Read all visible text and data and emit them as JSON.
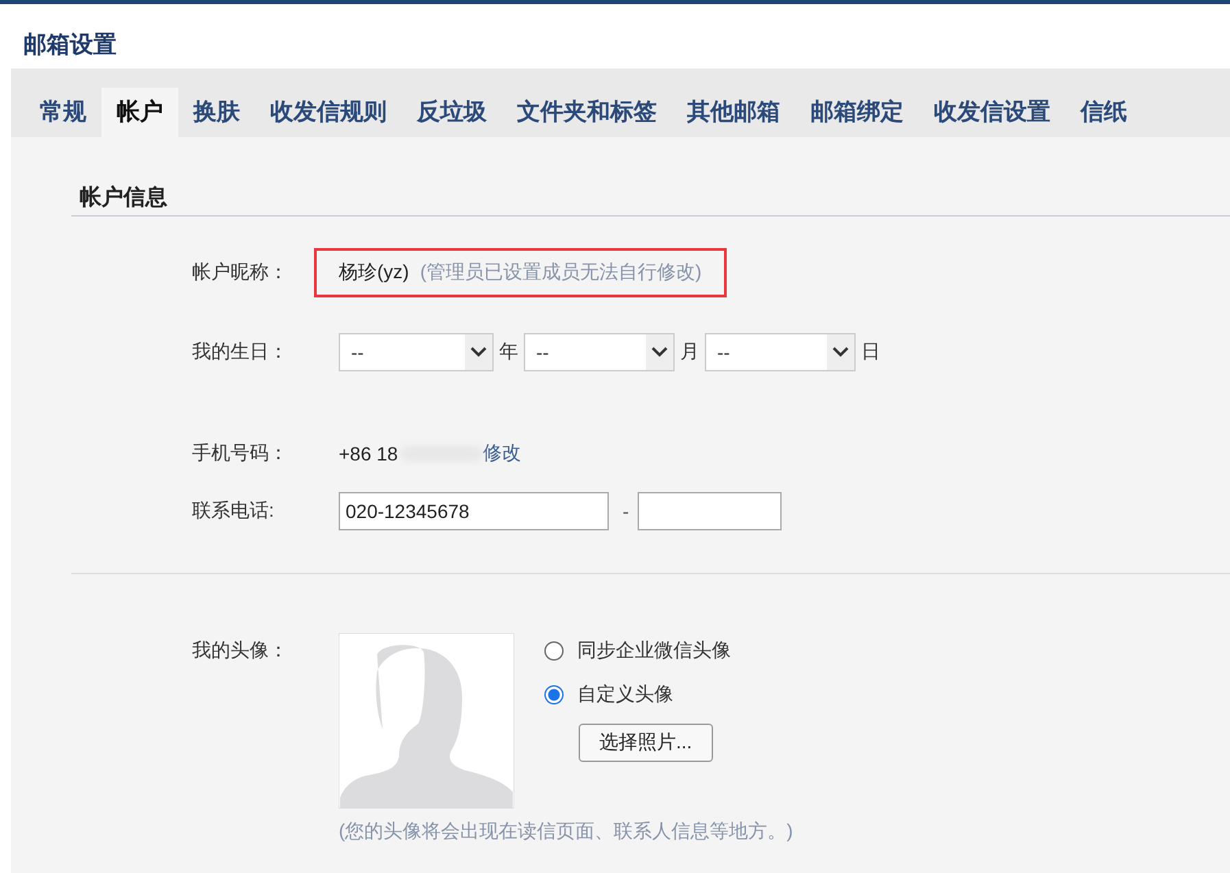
{
  "page_title": "邮箱设置",
  "tabs": [
    {
      "label": "常规",
      "selected": false
    },
    {
      "label": "帐户",
      "selected": true
    },
    {
      "label": "换肤",
      "selected": false
    },
    {
      "label": "收发信规则",
      "selected": false
    },
    {
      "label": "反垃圾",
      "selected": false
    },
    {
      "label": "文件夹和标签",
      "selected": false
    },
    {
      "label": "其他邮箱",
      "selected": false
    },
    {
      "label": "邮箱绑定",
      "selected": false
    },
    {
      "label": "收发信设置",
      "selected": false
    },
    {
      "label": "信纸",
      "selected": false
    }
  ],
  "section_title": "帐户信息",
  "nickname": {
    "label": "帐户昵称：",
    "value": "杨珍(yz)",
    "note": "(管理员已设置成员无法自行修改)",
    "highlighted": true
  },
  "birthday": {
    "label": "我的生日：",
    "selects": [
      {
        "value": "--",
        "unit": "年"
      },
      {
        "value": "--",
        "unit": "月"
      },
      {
        "value": "--",
        "unit": "日"
      }
    ]
  },
  "mobile": {
    "label": "手机号码：",
    "value": "+86 18",
    "redacted": true,
    "link": "修改"
  },
  "phone": {
    "label": "联系电话:",
    "value": "020-12345678",
    "separator": "-"
  },
  "avatar": {
    "label": "我的头像：",
    "options": [
      {
        "label": "同步企业微信头像",
        "selected": false
      },
      {
        "label": "自定义头像",
        "selected": true
      }
    ],
    "button": "选择照片...",
    "note": "(您的头像将会出现在读信页面、联系人信息等地方。)"
  }
}
